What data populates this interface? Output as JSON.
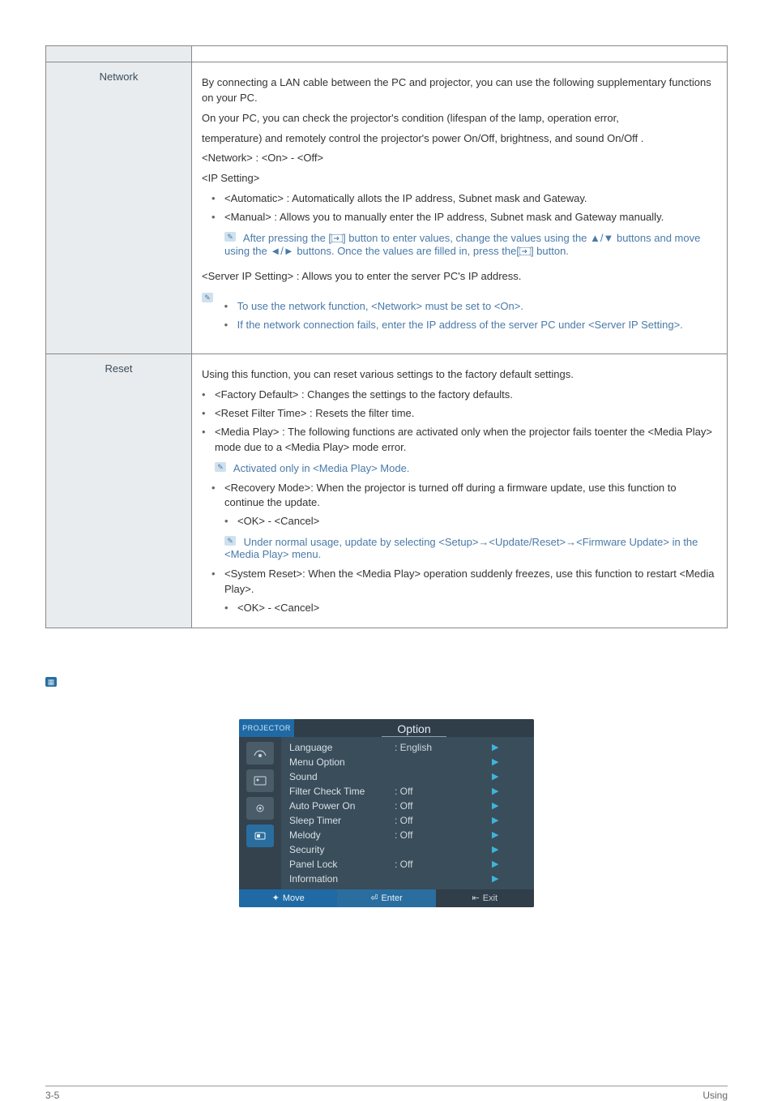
{
  "table": {
    "rows": [
      {
        "label": "Network",
        "body": {
          "p1": "By connecting a LAN cable between the PC and projector, you can use the following supplementary functions on your PC.",
          "p2": "On your PC, you can check the projector's condition (lifespan of the lamp, operation error,",
          "p3": "temperature) and remotely control the projector's power On/Off, brightness, and sound On/Off .",
          "p4": "<Network> : <On> - <Off>",
          "p5": "<IP Setting>",
          "b1": "<Automatic> : Automatically allots the IP address, Subnet mask and Gateway.",
          "b2": "<Manual> : Allows you to manually enter the IP address, Subnet mask and Gateway manually.",
          "note1a": "After pressing the [",
          "note1b": "] button to enter values, change the values using the ▲/▼ buttons and move using the ◄/► buttons. Once the values are filled in, press the[",
          "note1c": "] button.",
          "p6": "<Server IP Setting> : Allows you to enter the server PC's IP address.",
          "nl1": "To use the network function, <Network> must be set to <On>.",
          "nl2": "If the network connection fails, enter the IP address of the server PC under <Server IP Setting>."
        }
      },
      {
        "label": "Reset",
        "body": {
          "p1": "Using this function, you can reset various settings to the factory default settings.",
          "b1": "<Factory Default> : Changes the settings to the factory defaults.",
          "b2": "<Reset Filter Time> : Resets the filter time.",
          "b3": "<Media Play> : The following functions are activated only when the projector fails toenter the <Media Play> mode due to a <Media Play> mode error.",
          "note1": "Activated only in <Media Play> Mode.",
          "b4": "<Recovery Mode>: When the projector is turned off during a firmware update, use this function to continue the update.",
          "b4s": "<OK> - <Cancel>",
          "note2": "Under normal usage, update by selecting <Setup>→<Update/Reset>→<Firmware Update> in the <Media Play> menu.",
          "b5": "<System Reset>: When the <Media Play> operation suddenly freezes, use this function to restart <Media Play>.",
          "b5s": "<OK> - <Cancel>"
        }
      }
    ]
  },
  "osd": {
    "projector": "PROJECTOR",
    "title": "Option",
    "rows": [
      {
        "label": "Language",
        "value": ": English"
      },
      {
        "label": "Menu Option",
        "value": ""
      },
      {
        "label": "Sound",
        "value": ""
      },
      {
        "label": "Filter Check Time",
        "value": ": Off"
      },
      {
        "label": "Auto Power On",
        "value": ": Off"
      },
      {
        "label": "Sleep Timer",
        "value": ": Off"
      },
      {
        "label": "Melody",
        "value": ": Off"
      },
      {
        "label": "Security",
        "value": ""
      },
      {
        "label": "Panel Lock",
        "value": ": Off"
      },
      {
        "label": "Information",
        "value": ""
      }
    ],
    "footer": {
      "move": "Move",
      "enter": "Enter",
      "exit": "Exit"
    }
  },
  "page": {
    "left": "3-5",
    "right": "Using"
  }
}
